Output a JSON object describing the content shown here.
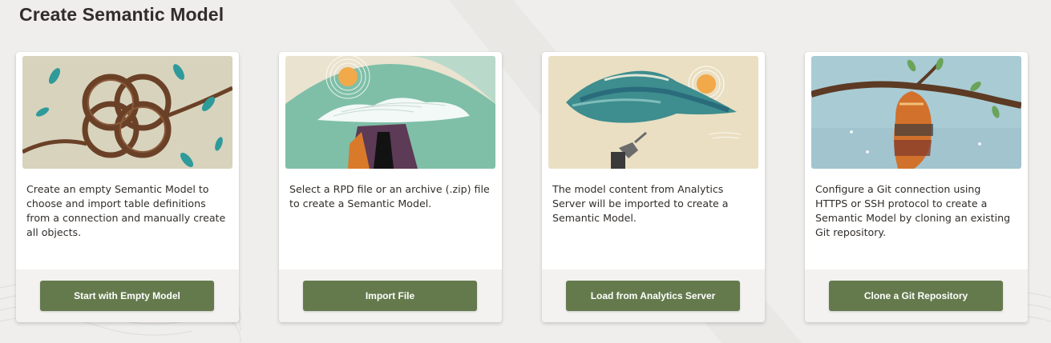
{
  "page": {
    "title": "Create Semantic Model"
  },
  "cards": [
    {
      "illustration": "interlocking-vine-rings",
      "description": "Create an empty Semantic Model to choose and import table definitions from a connection and manually create all objects.",
      "button_label": "Start with Empty Model"
    },
    {
      "illustration": "sun-over-figure",
      "description": "Select a RPD file or an archive (.zip) file to create a Semantic Model.",
      "button_label": "Import File"
    },
    {
      "illustration": "floating-island-figure",
      "description": "The model content from Analytics Server will be imported to create a Semantic Model.",
      "button_label": "Load from Analytics Server"
    },
    {
      "illustration": "branch-cocoon",
      "description": "Configure a Git connection using HTTPS or SSH protocol to create a Semantic Model by cloning an existing Git repository.",
      "button_label": "Clone a Git Repository"
    }
  ],
  "colors": {
    "page_background": "#efeeec",
    "card_background": "#ffffff",
    "card_footer": "#f4f2f0",
    "button_background": "#647a4d",
    "button_text": "#ffffff",
    "text": "#312d2a"
  }
}
